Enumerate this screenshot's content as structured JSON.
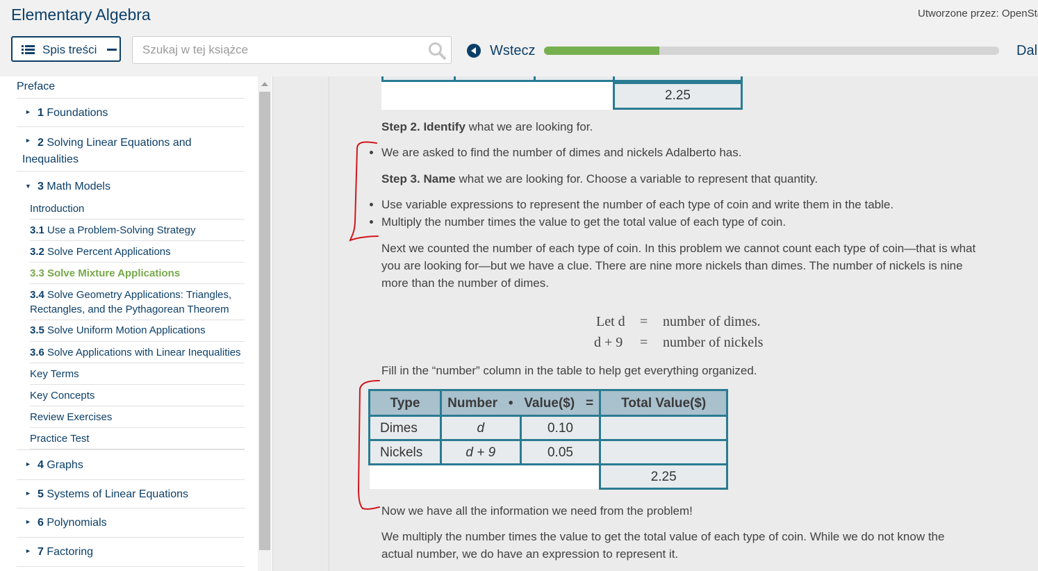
{
  "header": {
    "book_title": "Elementary Algebra",
    "created_by": "Utworzone przez: OpenSta",
    "toc_button_label": "Spis treści",
    "search_placeholder": "Szukaj w tej książce",
    "back_label": "Wstecz",
    "next_label": "Dal",
    "progress_fraction": 0.254
  },
  "sidebar": {
    "preface": "Preface",
    "ch1_num": "1",
    "ch1_title": "Foundations",
    "ch2_num": "2",
    "ch2_title": "Solving Linear Equations and Inequalities",
    "ch3_num": "3",
    "ch3_title": "Math Models",
    "ch3_items": [
      {
        "num": "",
        "title": "Introduction"
      },
      {
        "num": "3.1",
        "title": "Use a Problem-Solving Strategy"
      },
      {
        "num": "3.2",
        "title": "Solve Percent Applications"
      },
      {
        "num": "3.3",
        "title": "Solve Mixture Applications"
      },
      {
        "num": "3.4",
        "title": "Solve Geometry Applications: Triangles, Rectangles, and the Pythagorean Theorem"
      },
      {
        "num": "3.5",
        "title": "Solve Uniform Motion Applications"
      },
      {
        "num": "3.6",
        "title": "Solve Applications with Linear Inequalities"
      },
      {
        "num": "",
        "title": "Key Terms"
      },
      {
        "num": "",
        "title": "Key Concepts"
      },
      {
        "num": "",
        "title": "Review Exercises"
      },
      {
        "num": "",
        "title": "Practice Test"
      }
    ],
    "ch4_num": "4",
    "ch4_title": "Graphs",
    "ch5_num": "5",
    "ch5_title": "Systems of Linear Equations",
    "ch6_num": "6",
    "ch6_title": "Polynomials",
    "ch7_num": "7",
    "ch7_title": "Factoring"
  },
  "content": {
    "top_table_total": "2.25",
    "step2_bold": "Step 2. Identify",
    "step2_rest": " what we are looking for.",
    "bullet1": "We are asked to find the number of dimes and nickels Adalberto has.",
    "step3_bold": "Step 3. Name",
    "step3_rest": " what we are looking for. Choose a variable to represent that quantity.",
    "bullet2": "Use variable expressions to represent the number of each type of coin and write them in the table.",
    "bullet3": "Multiply the number times the value to get the total value of each type of coin.",
    "para_next": "Next we counted the number of each type of coin. In this problem we cannot count each type of coin—that is what you are looking for—but we have a clue. There are nine more nickels than dimes. The number of nickels is nine more than the number of dimes.",
    "math_line1_lhs": "Let d",
    "math_line1_eq": "=",
    "math_line1_rhs": "number of dimes.",
    "math_line2_lhs": "d + 9",
    "math_line2_eq": "=",
    "math_line2_rhs": "number of nickels",
    "fill_in": "Fill in the “number” column in the table to help get everything organized.",
    "table": {
      "headers": [
        "Type",
        "Number",
        "•",
        "Value($)",
        "=",
        "Total Value($)"
      ],
      "rows": [
        {
          "type": "Dimes",
          "number": "d",
          "value": "0.10",
          "total": ""
        },
        {
          "type": "Nickels",
          "number": "d + 9",
          "value": "0.05",
          "total": ""
        }
      ],
      "grand_total": "2.25"
    },
    "now_we_have": "Now we have all the information we need from the problem!",
    "multiply_para": "We multiply the number times the value to get the total value of each type of coin. While we do not know the actual number, we do have an expression to represent it."
  }
}
